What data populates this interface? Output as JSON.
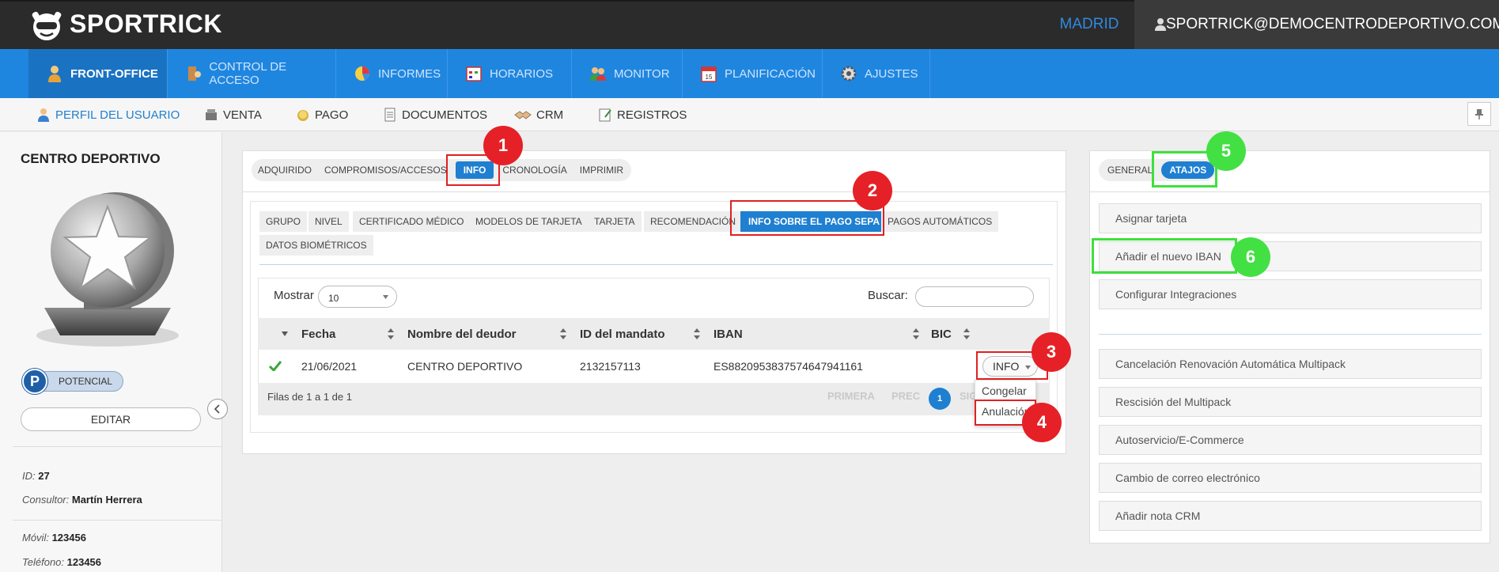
{
  "header": {
    "brand": "SPORTRICK",
    "city": "MADRID",
    "user_email": "SPORTRICK@DEMOCENTRODEPORTIVO.COM"
  },
  "main_nav": [
    {
      "label": "FRONT-OFFICE",
      "icon": "front-office-icon",
      "active": true
    },
    {
      "label": "CONTROL DE ACCESO",
      "icon": "access-control-icon"
    },
    {
      "label": "INFORMES",
      "icon": "pie-chart-icon"
    },
    {
      "label": "HORARIOS",
      "icon": "schedule-icon"
    },
    {
      "label": "MONITOR",
      "icon": "monitor-people-icon"
    },
    {
      "label": "PLANIFICACIÓN",
      "icon": "calendar-icon"
    },
    {
      "label": "AJUSTES",
      "icon": "gear-icon"
    }
  ],
  "sub_nav": [
    {
      "label": "PERFIL DEL USUARIO",
      "icon": "user-profile-icon",
      "active": true
    },
    {
      "label": "VENTA",
      "icon": "cash-register-icon"
    },
    {
      "label": "PAGO",
      "icon": "coin-icon"
    },
    {
      "label": "DOCUMENTOS",
      "icon": "document-icon"
    },
    {
      "label": "CRM",
      "icon": "handshake-icon"
    },
    {
      "label": "REGISTROS",
      "icon": "notepad-icon"
    }
  ],
  "profile": {
    "name": "CENTRO DEPORTIVO",
    "status_letter": "P",
    "status_label": "POTENCIAL",
    "edit_label": "EDITAR",
    "id_label": "ID:",
    "id_value": "27",
    "consultor_label": "Consultor:",
    "consultor_value": "Martín Herrera",
    "movil_label": "Móvil:",
    "movil_value": "123456",
    "telefono_label": "Teléfono:",
    "telefono_value": "123456"
  },
  "top_tabs": [
    "ADQUIRIDO",
    "COMPROMISOS/ACCESOS",
    "INFO",
    "CRONOLOGÍA",
    "IMPRIMIR"
  ],
  "info_tabs_row1": [
    "GRUPO",
    "NIVEL",
    "CERTIFICADO MÉDICO",
    "MODELOS DE TARJETA",
    "TARJETA",
    "RECOMENDACIÓN",
    "INFO SOBRE EL PAGO SEPA",
    "PAGOS AUTOMÁTICOS"
  ],
  "info_tabs_row2": [
    "DATOS BIOMÉTRICOS"
  ],
  "table": {
    "show_label": "Mostrar",
    "show_value": "10",
    "search_label": "Buscar:",
    "search_value": "",
    "headers": [
      "Fecha",
      "Nombre del deudor",
      "ID del mandato",
      "IBAN",
      "BIC"
    ],
    "rows": [
      {
        "fecha": "21/06/2021",
        "deudor": "CENTRO DEPORTIVO",
        "mandato": "2132157113",
        "iban": "ES8820953837574647941161",
        "bic": "",
        "action": "INFO"
      }
    ],
    "footer": "Filas de 1 a 1 de 1",
    "pagination": {
      "first": "PRIMERA",
      "prev": "PREC",
      "current": "1",
      "next": "SIG"
    },
    "dropdown": [
      "Congelar",
      "Anulación"
    ]
  },
  "right_tabs": [
    "GENERAL",
    "ATAJOS"
  ],
  "shortcuts_group1": [
    "Asignar tarjeta",
    "Añadir el nuevo IBAN",
    "Configurar Integraciones"
  ],
  "shortcuts_group2": [
    "Cancelación Renovación Automática Multipack",
    "Rescisión del Multipack",
    "Autoservicio/E-Commerce",
    "Cambio de correo electrónico",
    "Añadir nota CRM"
  ],
  "markers": [
    "1",
    "2",
    "3",
    "4",
    "5",
    "6"
  ],
  "colors": {
    "nav_blue": "#1f86e0",
    "accent_blue": "#1f7fd1",
    "marker_red": "#e52127",
    "marker_green": "#43e043"
  }
}
